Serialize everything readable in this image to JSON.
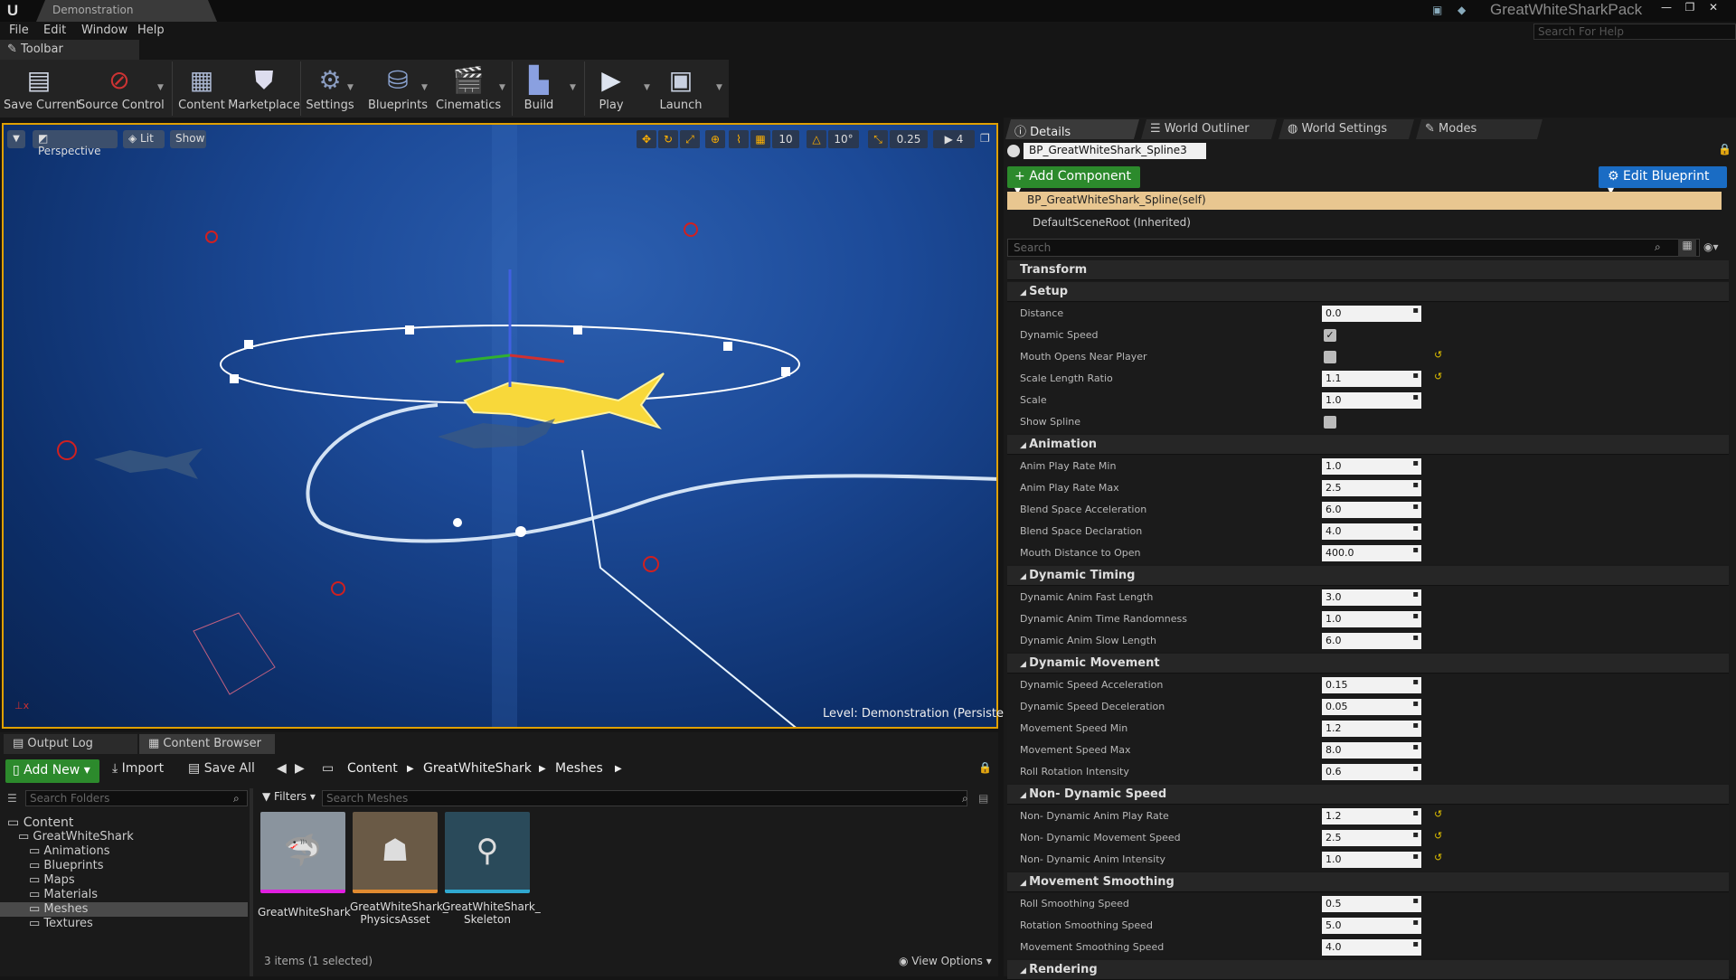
{
  "window": {
    "tab": "Demonstration",
    "project": "GreatWhiteSharkPack",
    "help_placeholder": "Search For Help"
  },
  "menu": [
    "File",
    "Edit",
    "Window",
    "Help"
  ],
  "toolbar": {
    "tab": "Toolbar",
    "buttons": [
      "Save Current",
      "Source Control",
      "Content",
      "Marketplace",
      "Settings",
      "Blueprints",
      "Cinematics",
      "Build",
      "Play",
      "Launch"
    ]
  },
  "viewport": {
    "perspective": "Perspective",
    "lit": "Lit",
    "show": "Show",
    "grid_snap": "10",
    "rot_snap": "10°",
    "scale_snap": "0.25",
    "cam_speed": "4",
    "level_label": "Level:",
    "level_name": "Demonstration (Persistent)"
  },
  "details": {
    "tabs": [
      "Details",
      "World Outliner",
      "World Settings",
      "Modes"
    ],
    "component_name": "BP_GreatWhiteShark_Spline3",
    "add_component": "Add Component",
    "edit_blueprint": "Edit Blueprint",
    "self_row": "BP_GreatWhiteShark_Spline(self)",
    "root_row": "DefaultSceneRoot (Inherited)",
    "search_placeholder": "Search",
    "transform": "Transform",
    "categories": [
      {
        "name": "Setup",
        "props": [
          {
            "label": "Distance",
            "value": "0.0"
          },
          {
            "label": "Dynamic Speed",
            "check": true
          },
          {
            "label": "Mouth Opens Near Player",
            "check": false,
            "reset": true
          },
          {
            "label": "Scale Length Ratio",
            "value": "1.1",
            "reset": true
          },
          {
            "label": "Scale",
            "value": "1.0"
          },
          {
            "label": "Show Spline",
            "check": false
          }
        ]
      },
      {
        "name": "Animation",
        "props": [
          {
            "label": "Anim Play Rate Min",
            "value": "1.0"
          },
          {
            "label": "Anim Play Rate Max",
            "value": "2.5"
          },
          {
            "label": "Blend Space Acceleration",
            "value": "6.0"
          },
          {
            "label": "Blend Space Declaration",
            "value": "4.0"
          },
          {
            "label": "Mouth Distance to Open",
            "value": "400.0"
          }
        ]
      },
      {
        "name": "Dynamic Timing",
        "props": [
          {
            "label": "Dynamic Anim Fast Length",
            "value": "3.0"
          },
          {
            "label": "Dynamic Anim Time Randomness",
            "value": "1.0"
          },
          {
            "label": "Dynamic Anim Slow Length",
            "value": "6.0"
          }
        ]
      },
      {
        "name": "Dynamic Movement",
        "props": [
          {
            "label": "Dynamic Speed Acceleration",
            "value": "0.15"
          },
          {
            "label": "Dynamic Speed Deceleration",
            "value": "0.05"
          },
          {
            "label": "Movement Speed Min",
            "value": "1.2"
          },
          {
            "label": "Movement Speed Max",
            "value": "8.0"
          },
          {
            "label": "Roll Rotation Intensity",
            "value": "0.6"
          }
        ]
      },
      {
        "name": "Non- Dynamic Speed",
        "props": [
          {
            "label": "Non- Dynamic Anim Play Rate",
            "value": "1.2",
            "reset": true
          },
          {
            "label": "Non- Dynamic Movement Speed",
            "value": "2.5",
            "reset": true
          },
          {
            "label": "Non- Dynamic Anim Intensity",
            "value": "1.0",
            "reset": true
          }
        ]
      },
      {
        "name": "Movement Smoothing",
        "props": [
          {
            "label": "Roll Smoothing Speed",
            "value": "0.5"
          },
          {
            "label": "Rotation Smoothing Speed",
            "value": "5.0"
          },
          {
            "label": "Movement Smoothing Speed",
            "value": "4.0"
          }
        ]
      },
      {
        "name": "Rendering",
        "props": []
      }
    ]
  },
  "bottom": {
    "tabs": [
      "Output Log",
      "Content Browser"
    ],
    "add_new": "Add New",
    "import": "Import",
    "save_all": "Save All",
    "breadcrumb": [
      "Content",
      "GreatWhiteShark",
      "Meshes"
    ],
    "folder_placeholder": "Search Folders",
    "filters": "Filters",
    "mesh_placeholder": "Search Meshes",
    "tree": [
      {
        "label": "Content",
        "level": 0
      },
      {
        "label": "GreatWhiteShark",
        "level": 1
      },
      {
        "label": "Animations",
        "level": 2
      },
      {
        "label": "Blueprints",
        "level": 2
      },
      {
        "label": "Maps",
        "level": 2
      },
      {
        "label": "Materials",
        "level": 2
      },
      {
        "label": "Meshes",
        "level": 2,
        "selected": true
      },
      {
        "label": "Textures",
        "level": 2
      }
    ],
    "assets": [
      {
        "label": "GreatWhiteShark",
        "color": "#e020e0"
      },
      {
        "label": "GreatWhiteShark_ PhysicsAsset",
        "color": "#e08a30"
      },
      {
        "label": "GreatWhiteShark_ Skeleton",
        "color": "#30a8d0"
      }
    ],
    "item_count": "3 items (1 selected)",
    "view_options": "View Options"
  }
}
